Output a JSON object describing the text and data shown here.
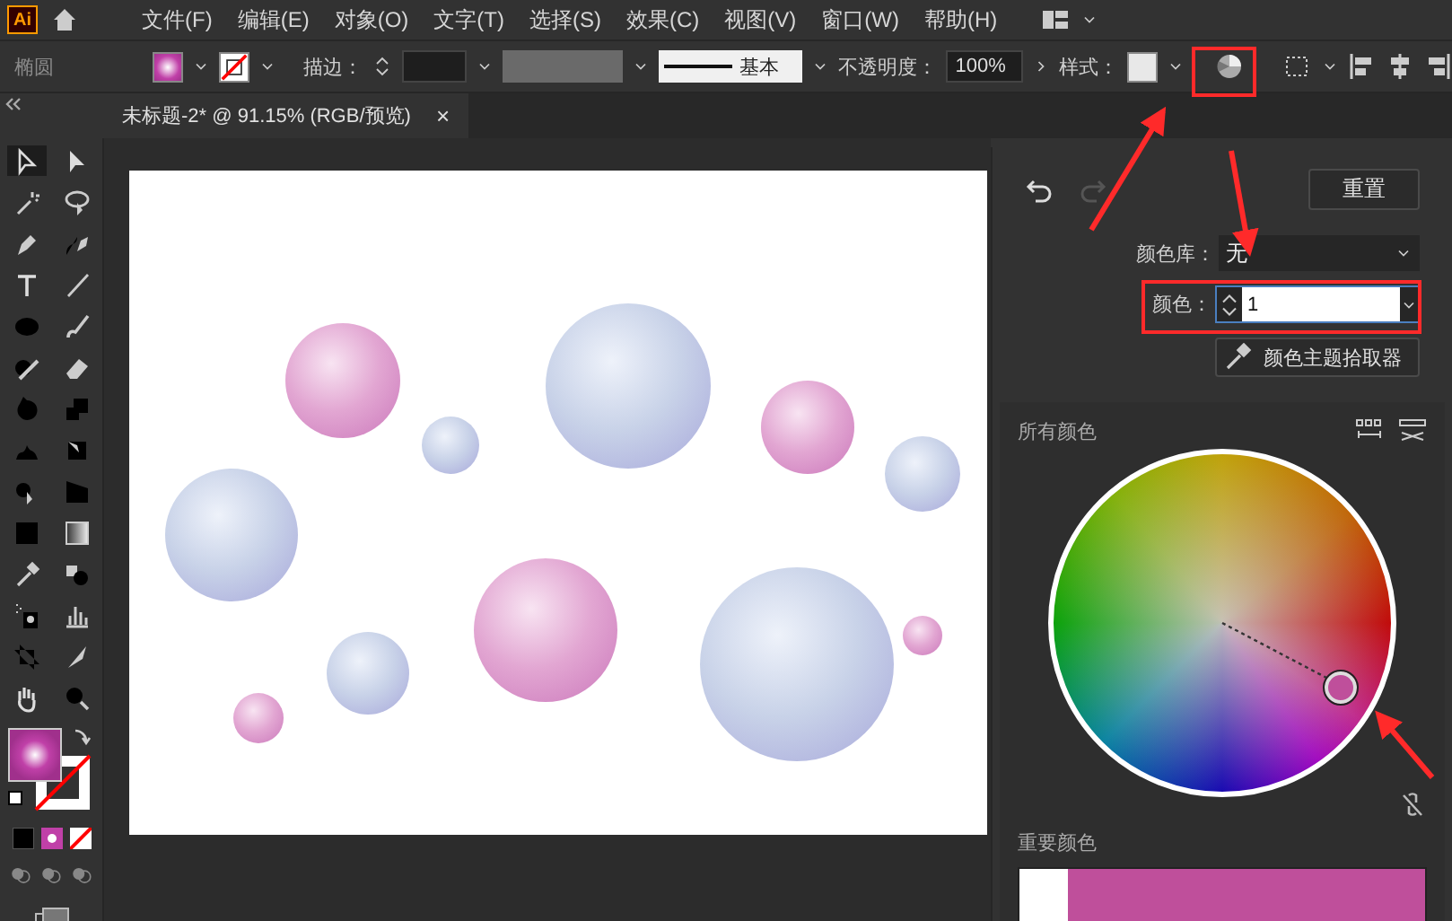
{
  "menu_bar": {
    "logo": "Ai",
    "items": [
      "文件(F)",
      "编辑(E)",
      "对象(O)",
      "文字(T)",
      "选择(S)",
      "效果(C)",
      "视图(V)",
      "窗口(W)",
      "帮助(H)"
    ]
  },
  "control_bar": {
    "object_type": "椭圆",
    "stroke_label": "描边：",
    "stroke_style": "基本",
    "opacity_label": "不透明度：",
    "opacity_value": "100%",
    "style_label": "样式："
  },
  "document_tab": {
    "title": "未标题-2* @ 91.15% (RGB/预览)",
    "close": "×"
  },
  "panel": {
    "reset_button": "重置",
    "library_label": "颜色库：",
    "library_value": "无",
    "colors_label": "颜色：",
    "colors_value": "1",
    "picker_button": "颜色主题拾取器",
    "all_colors_label": "所有颜色",
    "key_colors_label": "重要颜色",
    "key_colors": [
      {
        "color": "#ffffff"
      },
      {
        "color": "#bf4f9b"
      }
    ]
  }
}
